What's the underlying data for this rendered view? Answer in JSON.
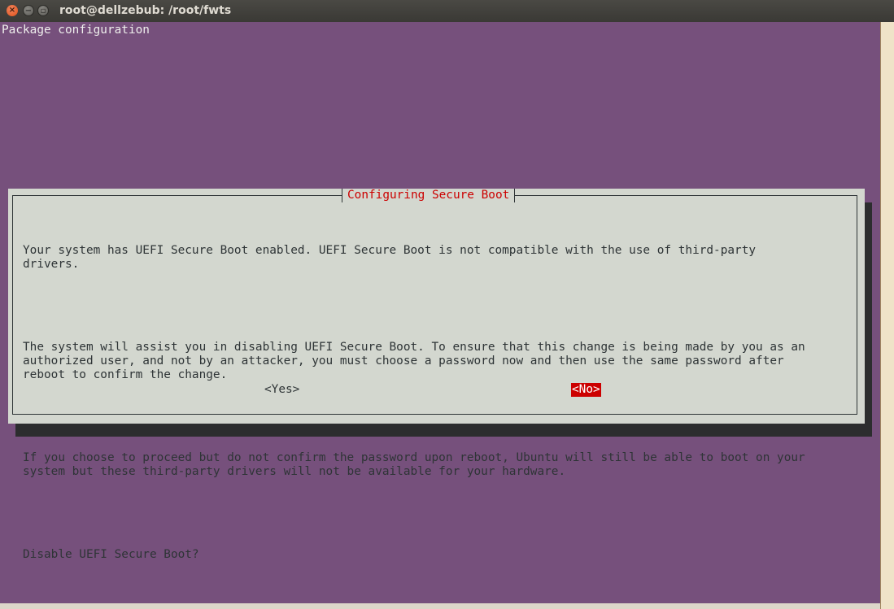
{
  "window": {
    "title": "root@dellzebub: /root/fwts",
    "controls": [
      "close-icon",
      "minimize-icon",
      "maximize-icon"
    ]
  },
  "terminal": {
    "header": "Package configuration"
  },
  "dialog": {
    "title": "Configuring Secure Boot",
    "paragraphs": [
      "Your system has UEFI Secure Boot enabled. UEFI Secure Boot is not compatible with the use of third-party\ndrivers.",
      "The system will assist you in disabling UEFI Secure Boot. To ensure that this change is being made by you as an\nauthorized user, and not by an attacker, you must choose a password now and then use the same password after\nreboot to confirm the change.",
      "If you choose to proceed but do not confirm the password upon reboot, Ubuntu will still be able to boot on your\nsystem but these third-party drivers will not be available for your hardware.",
      "Disable UEFI Secure Boot?"
    ],
    "buttons": {
      "yes": "<Yes>",
      "no": "<No>"
    },
    "selected_button": "no"
  },
  "colors": {
    "terminal_bg": "#76507c",
    "dialog_bg": "#d3d7cf",
    "accent_red": "#cc0000"
  }
}
